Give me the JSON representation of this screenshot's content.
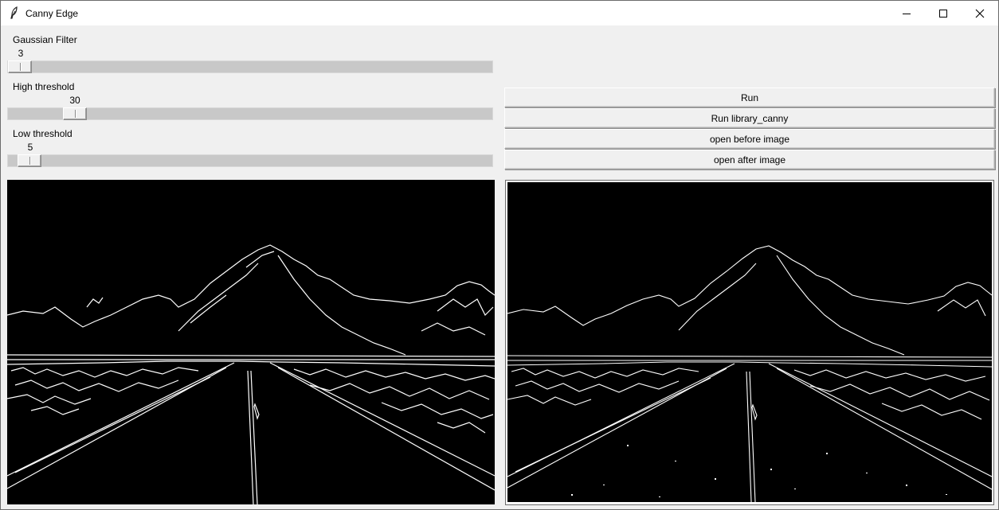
{
  "window": {
    "title": "Canny Edge"
  },
  "sliders": [
    {
      "label": "Gaussian Filter",
      "value": "3",
      "fraction": 0.0
    },
    {
      "label": "High threshold",
      "value": "30",
      "fraction": 0.12
    },
    {
      "label": "Low threshold",
      "value": "5",
      "fraction": 0.02
    }
  ],
  "buttons": {
    "run": "Run",
    "run_library": "Run library_canny",
    "open_before": "open before image",
    "open_after": "open after image"
  },
  "images": {
    "left": "custom canny edge output",
    "right": "library canny edge output"
  }
}
